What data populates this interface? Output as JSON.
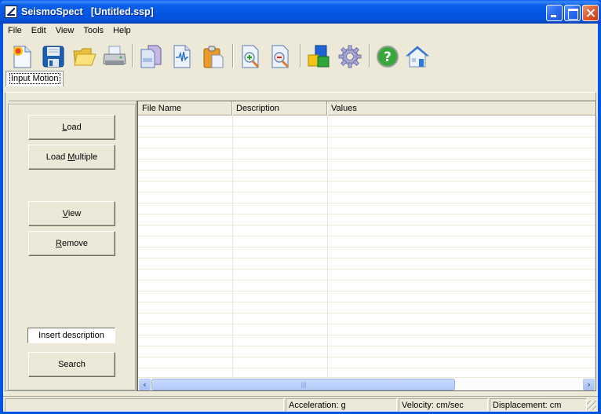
{
  "window": {
    "title": "SeismoSpect   [Untitled.ssp]",
    "controls": [
      "minimize",
      "maximize",
      "close"
    ]
  },
  "menu": [
    "File",
    "Edit",
    "View",
    "Tools",
    "Help"
  ],
  "toolbar": [
    {
      "name": "new-icon",
      "label": "New"
    },
    {
      "name": "save-icon",
      "label": "Save"
    },
    {
      "name": "open-folder-icon",
      "label": "Open"
    },
    {
      "name": "print-icon",
      "label": "Print"
    },
    {
      "name": "copy-icon",
      "label": "Copy"
    },
    {
      "name": "waveform-document-icon",
      "label": "Copy Graph"
    },
    {
      "name": "paste-icon",
      "label": "Paste"
    },
    {
      "name": "zoom-in-icon",
      "label": "Zoom In"
    },
    {
      "name": "zoom-out-icon",
      "label": "Zoom Out"
    },
    {
      "name": "modules-cubes-icon",
      "label": "Modules"
    },
    {
      "name": "gear-icon",
      "label": "Settings"
    },
    {
      "name": "help-icon",
      "label": "Help"
    },
    {
      "name": "home-icon",
      "label": "Home"
    }
  ],
  "tabs": [
    {
      "label": "Input Motion",
      "active": true
    }
  ],
  "left_panel": {
    "load_label_u": "L",
    "load_label_rest": "oad",
    "load_multiple_pre": "Load ",
    "load_multiple_u": "M",
    "load_multiple_rest": "ultiple",
    "view_u": "V",
    "view_rest": "iew",
    "remove_u": "R",
    "remove_rest": "emove",
    "description_value": "Insert description",
    "search_label": "Search"
  },
  "table": {
    "columns": [
      "File Name",
      "Description",
      "Values"
    ],
    "rows": []
  },
  "statusbar": {
    "panes": [
      "",
      "Acceleration: g",
      "Velocity: cm/sec",
      "Displacement: cm"
    ]
  }
}
